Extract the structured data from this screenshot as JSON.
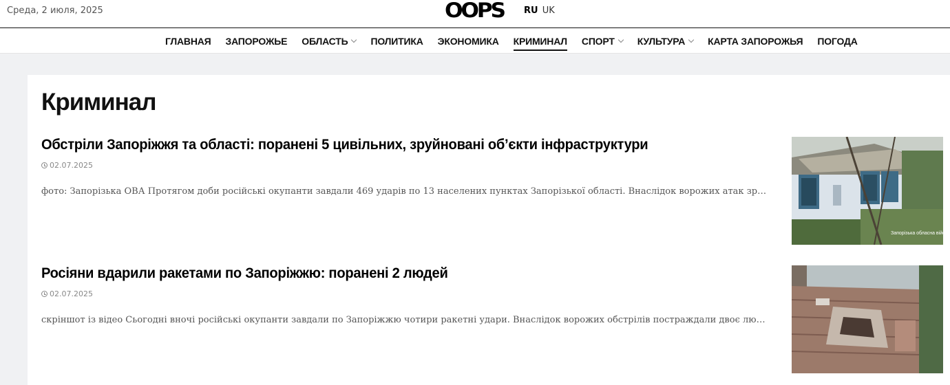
{
  "header": {
    "date": "Среда, 2 июля, 2025",
    "logo": "OOPS",
    "lang_ru": "RU",
    "lang_uk": "UK"
  },
  "nav": {
    "items": [
      {
        "label": "ГЛАВНАЯ"
      },
      {
        "label": "ЗАПОРОЖЬЕ"
      },
      {
        "label": "ОБЛАСТЬ"
      },
      {
        "label": "ПОЛИТИКА"
      },
      {
        "label": "ЭКОНОМИКА"
      },
      {
        "label": "КРИМИНАЛ"
      },
      {
        "label": "СПОРТ"
      },
      {
        "label": "КУЛЬТУРА"
      },
      {
        "label": "КАРТА ЗАПОРОЖЬЯ"
      },
      {
        "label": "ПОГОДА"
      }
    ]
  },
  "page": {
    "title": "Криминал"
  },
  "articles": [
    {
      "title": "Обстріли Запоріжжя та області: поранені 5 цивільних, зруйновані об’єкти інфраструктури",
      "date": "02.07.2025",
      "excerpt": "фото: Запорізька ОВА Протягом доби російські окупанти завдали 469 ударів по 13 населених пунктах Запорізької області. Внаслідок ворожих атак зруйновані...",
      "image_watermark": "Запорізька обласна військова адміністрація"
    },
    {
      "title": "Росіяни вдарили ракетами по Запоріжжю: поранені 2 людей",
      "date": "02.07.2025",
      "excerpt": "скріншот із відео Сьогодні вночі російські окупанти завдали по Запоріжжю чотири ракетні удари. Внаслідок ворожих обстрілів постраждали двоє людей Про..."
    }
  ],
  "colors": {
    "background": "#f0f1f3",
    "panel": "#ffffff",
    "text": "#111111",
    "meta": "#888888"
  }
}
